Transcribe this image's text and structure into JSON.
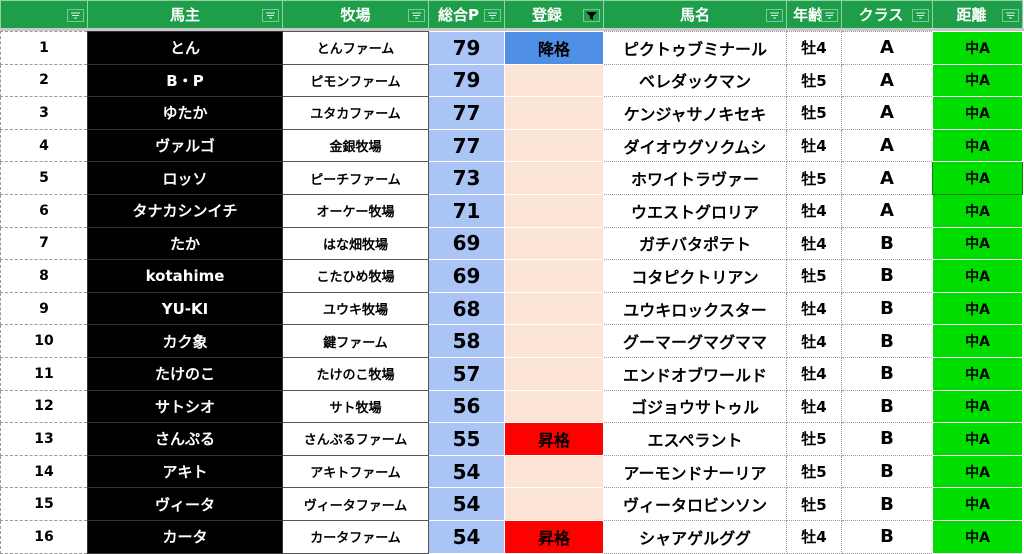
{
  "headers": {
    "rank": "",
    "owner": "馬主",
    "ranch": "牧場",
    "score": "総合P",
    "registration": "登録",
    "horse": "馬名",
    "age": "年齢",
    "class": "クラス",
    "distance": "距離"
  },
  "colors": {
    "header_green": "#1f9e4a",
    "score_blue": "#a9c4f5",
    "demoted_blue": "#4f8fe6",
    "promoted_red": "#ff0000",
    "registration_peach": "#fce4d6",
    "distance_green": "#00dd00"
  },
  "rows": [
    {
      "rank": "1",
      "owner": "とん",
      "ranch": "とんファーム",
      "score": "79",
      "registration": "降格",
      "horse": "ピクトゥブミナール",
      "age": "牡4",
      "class": "A",
      "distance": "中A"
    },
    {
      "rank": "2",
      "owner": "B・P",
      "ranch": "ピモンファーム",
      "score": "79",
      "registration": "",
      "horse": "ベレダックマン",
      "age": "牡5",
      "class": "A",
      "distance": "中A"
    },
    {
      "rank": "3",
      "owner": "ゆたか",
      "ranch": "ユタカファーム",
      "score": "77",
      "registration": "",
      "horse": "ケンジャサノキセキ",
      "age": "牡5",
      "class": "A",
      "distance": "中A"
    },
    {
      "rank": "4",
      "owner": "ヴァルゴ",
      "ranch": "金銀牧場",
      "score": "77",
      "registration": "",
      "horse": "ダイオウグソクムシ",
      "age": "牡4",
      "class": "A",
      "distance": "中A"
    },
    {
      "rank": "5",
      "owner": "ロッソ",
      "ranch": "ピーチファーム",
      "score": "73",
      "registration": "",
      "horse": "ホワイトラヴァー",
      "age": "牡5",
      "class": "A",
      "distance": "中A"
    },
    {
      "rank": "6",
      "owner": "タナカシンイチ",
      "ranch": "オーケー牧場",
      "score": "71",
      "registration": "",
      "horse": "ウエストグロリア",
      "age": "牡4",
      "class": "A",
      "distance": "中A"
    },
    {
      "rank": "7",
      "owner": "たか",
      "ranch": "はな畑牧場",
      "score": "69",
      "registration": "",
      "horse": "ガチバタポテト",
      "age": "牡4",
      "class": "B",
      "distance": "中A"
    },
    {
      "rank": "8",
      "owner": "kotahime",
      "ranch": "こたひめ牧場",
      "score": "69",
      "registration": "",
      "horse": "コタピクトリアン",
      "age": "牡5",
      "class": "B",
      "distance": "中A"
    },
    {
      "rank": "9",
      "owner": "YU-KI",
      "ranch": "ユウキ牧場",
      "score": "68",
      "registration": "",
      "horse": "ユウキロックスター",
      "age": "牡4",
      "class": "B",
      "distance": "中A"
    },
    {
      "rank": "10",
      "owner": "カク象",
      "ranch": "鍵ファーム",
      "score": "58",
      "registration": "",
      "horse": "グーマーグマグママ",
      "age": "牡4",
      "class": "B",
      "distance": "中A"
    },
    {
      "rank": "11",
      "owner": "たけのこ",
      "ranch": "たけのこ牧場",
      "score": "57",
      "registration": "",
      "horse": "エンドオブワールド",
      "age": "牡4",
      "class": "B",
      "distance": "中A"
    },
    {
      "rank": "12",
      "owner": "サトシオ",
      "ranch": "サト牧場",
      "score": "56",
      "registration": "",
      "horse": "ゴジョウサトゥル",
      "age": "牡4",
      "class": "B",
      "distance": "中A"
    },
    {
      "rank": "13",
      "owner": "さんぷる",
      "ranch": "さんぷるファーム",
      "score": "55",
      "registration": "昇格",
      "horse": "エスペラント",
      "age": "牡5",
      "class": "B",
      "distance": "中A"
    },
    {
      "rank": "14",
      "owner": "アキト",
      "ranch": "アキトファーム",
      "score": "54",
      "registration": "",
      "horse": "アーモンドナーリア",
      "age": "牡5",
      "class": "B",
      "distance": "中A"
    },
    {
      "rank": "15",
      "owner": "ヴィータ",
      "ranch": "ヴィータファーム",
      "score": "54",
      "registration": "",
      "horse": "ヴィータロビンソン",
      "age": "牡5",
      "class": "B",
      "distance": "中A"
    },
    {
      "rank": "16",
      "owner": "カータ",
      "ranch": "カータファーム",
      "score": "54",
      "registration": "昇格",
      "horse": "シャアゲルググ",
      "age": "牡4",
      "class": "B",
      "distance": "中A"
    }
  ]
}
